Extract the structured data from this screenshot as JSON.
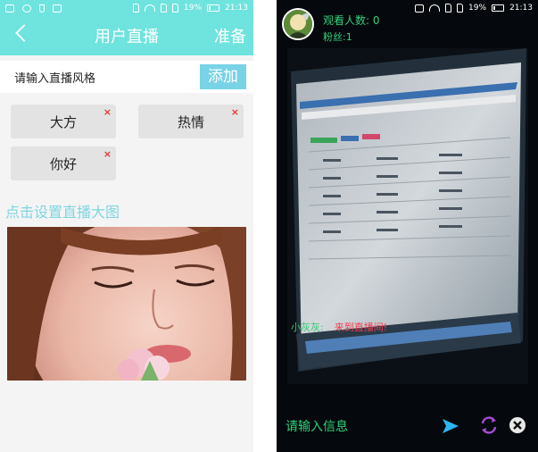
{
  "left": {
    "status_bar": {
      "battery": "19%",
      "time": "21:13"
    },
    "header": {
      "title": "用户直播",
      "action": "准备"
    },
    "style_input": {
      "placeholder": "请输入直播风格",
      "add_label": "添加"
    },
    "tags": [
      {
        "label": "大方",
        "remove": "×"
      },
      {
        "label": "热情",
        "remove": "×"
      },
      {
        "label": "你好",
        "remove": "×"
      }
    ],
    "cover_hint": "点击设置直播大图"
  },
  "right": {
    "status_bar": {
      "battery": "19%",
      "time": "21:13"
    },
    "viewers": "观看人数: 0",
    "fans": "粉丝:1",
    "chat": {
      "name": "小灰灰:",
      "message": "来到直播间!"
    },
    "message_input_placeholder": "请输入信息",
    "icons": [
      "send-icon",
      "switch-camera-icon",
      "close-icon"
    ]
  },
  "colors": {
    "accent": "#6fe3de",
    "button": "#79d3e6",
    "chat_name": "#32c96a",
    "chat_msg": "#f23c4c"
  }
}
